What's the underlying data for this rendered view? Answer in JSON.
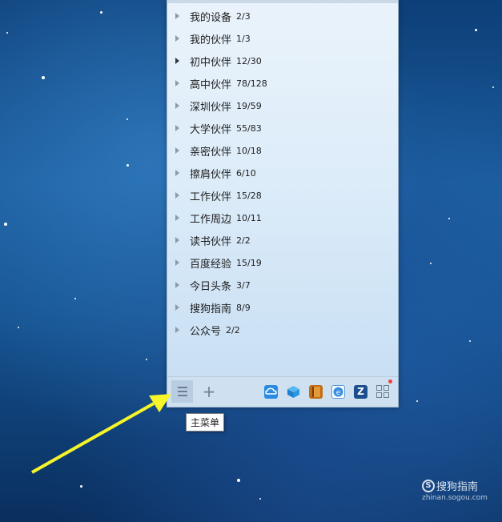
{
  "groups": [
    {
      "name": "我的设备",
      "count": "2/3",
      "selected": false
    },
    {
      "name": "我的伙伴",
      "count": "1/3",
      "selected": false
    },
    {
      "name": "初中伙伴",
      "count": "12/30",
      "selected": true
    },
    {
      "name": "高中伙伴",
      "count": "78/128",
      "selected": false
    },
    {
      "name": "深圳伙伴",
      "count": "19/59",
      "selected": false
    },
    {
      "name": "大学伙伴",
      "count": "55/83",
      "selected": false
    },
    {
      "name": "亲密伙伴",
      "count": "10/18",
      "selected": false
    },
    {
      "name": "擦肩伙伴",
      "count": "6/10",
      "selected": false
    },
    {
      "name": "工作伙伴",
      "count": "15/28",
      "selected": false
    },
    {
      "name": "工作周边",
      "count": "10/11",
      "selected": false
    },
    {
      "name": "读书伙伴",
      "count": "2/2",
      "selected": false
    },
    {
      "name": "百度经验",
      "count": "15/19",
      "selected": false
    },
    {
      "name": "今日头条",
      "count": "3/7",
      "selected": false
    },
    {
      "name": "搜狗指南",
      "count": "8/9",
      "selected": false
    },
    {
      "name": "公众号",
      "count": "2/2",
      "selected": false
    }
  ],
  "bottombar": {
    "menu_icon": "hamburger-menu-icon",
    "add_icon": "plus-icon",
    "tray_icons": [
      "cloud-drive-icon",
      "cube-app-icon",
      "book-icon",
      "browser-icon",
      "z-app-icon",
      "app-grid-icon"
    ],
    "tray5_glyph": "Z",
    "has_notification_dot": true,
    "notification_color": "#f04040"
  },
  "tooltip": {
    "text": "主菜单"
  },
  "watermark": {
    "logo_glyph": "S",
    "text": "搜狗指南",
    "url": "zhinan.sogou.com"
  },
  "annotation": {
    "color": "#f5f52a",
    "shape": "arrow"
  }
}
